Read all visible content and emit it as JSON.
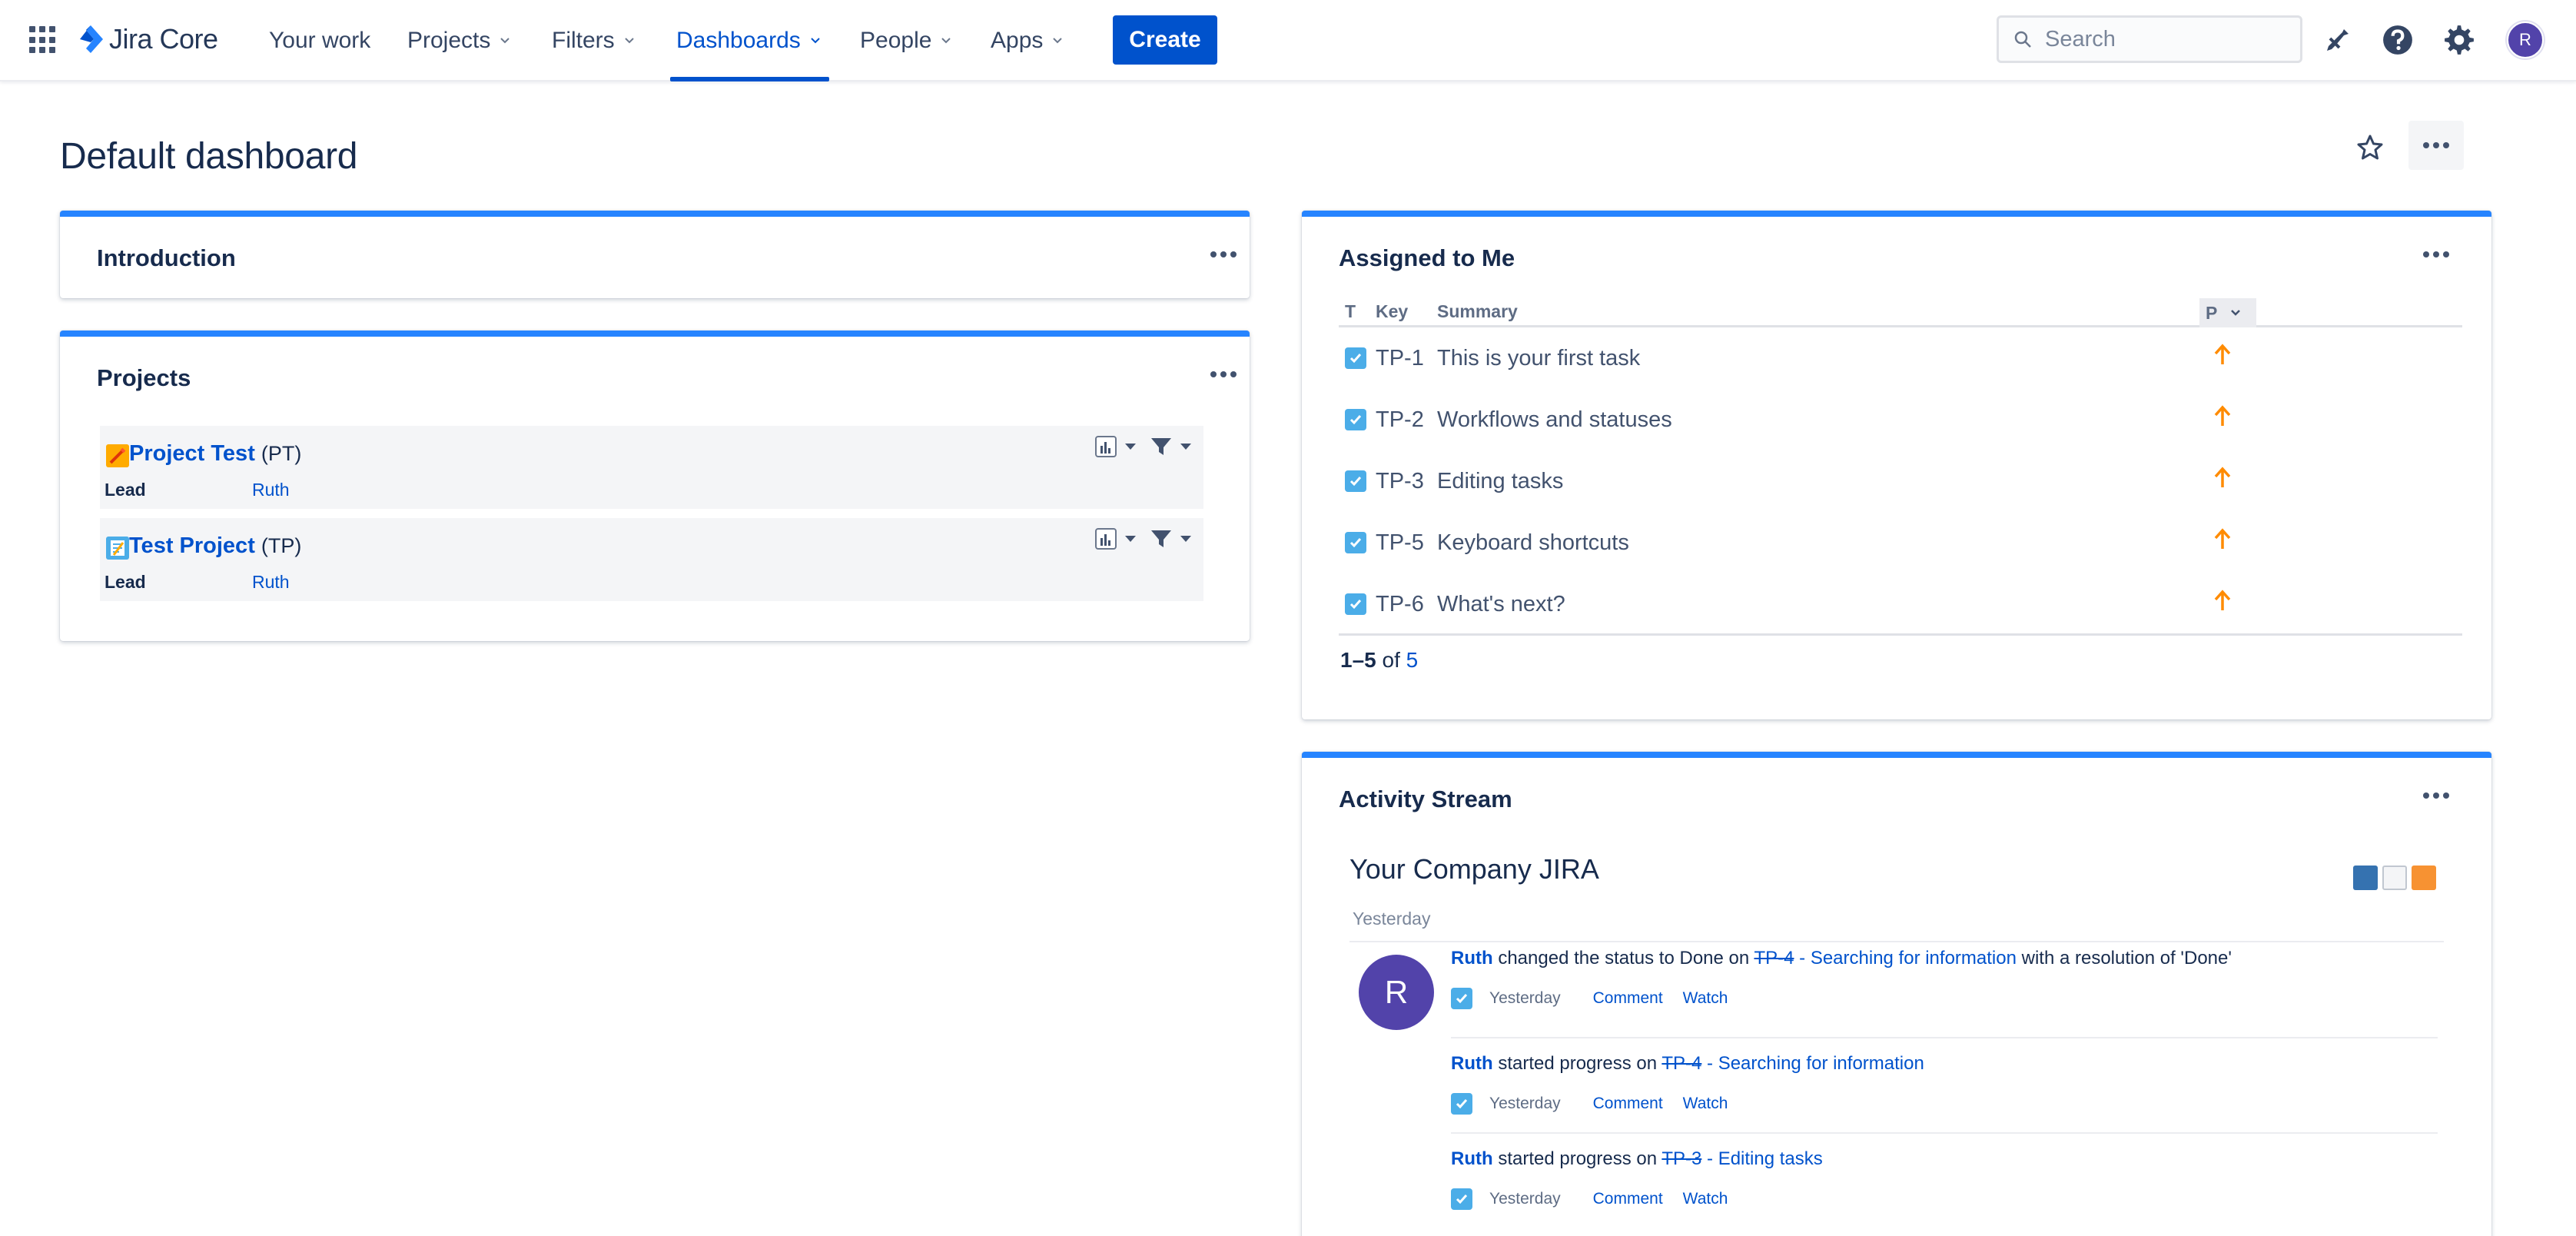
{
  "nav": {
    "product": "Jira Core",
    "items": [
      {
        "label": "Your work",
        "has_menu": false
      },
      {
        "label": "Projects",
        "has_menu": true
      },
      {
        "label": "Filters",
        "has_menu": true
      },
      {
        "label": "Dashboards",
        "has_menu": true,
        "active": true
      },
      {
        "label": "People",
        "has_menu": true
      },
      {
        "label": "Apps",
        "has_menu": true
      }
    ],
    "create_label": "Create",
    "search_placeholder": "Search",
    "avatar_initial": "R",
    "accent": "#0052cc"
  },
  "page": {
    "title": "Default dashboard"
  },
  "gadgets": {
    "introduction": {
      "title": "Introduction"
    },
    "projects": {
      "title": "Projects",
      "items": [
        {
          "name": "Project Test",
          "key": "(PT)",
          "lead_label": "Lead",
          "lead": "Ruth"
        },
        {
          "name": "Test Project",
          "key": "(TP)",
          "lead_label": "Lead",
          "lead": "Ruth"
        }
      ]
    },
    "assigned": {
      "title": "Assigned to Me",
      "columns": {
        "t": "T",
        "key": "Key",
        "summary": "Summary",
        "p": "P"
      },
      "rows": [
        {
          "key": "TP-1",
          "summary": "This is your first task"
        },
        {
          "key": "TP-2",
          "summary": "Workflows and statuses"
        },
        {
          "key": "TP-3",
          "summary": "Editing tasks"
        },
        {
          "key": "TP-5",
          "summary": "Keyboard shortcuts"
        },
        {
          "key": "TP-6",
          "summary": "What's next?"
        }
      ],
      "pager": {
        "range": "1–5",
        "of": "of",
        "total": "5"
      },
      "priority_color": "#ff8b00",
      "type_color": "#4bade8"
    },
    "activity": {
      "title": "Activity Stream",
      "stream_title": "Your Company JIRA",
      "date_group": "Yesterday",
      "avatar_initial": "R",
      "entries": [
        {
          "user": "Ruth",
          "text1": " changed the status to Done on ",
          "link_key": "TP-4",
          "link_rest": " - Searching for information",
          "text2": " with a resolution of 'Done'",
          "when": "Yesterday",
          "comment": "Comment",
          "watch": "Watch"
        },
        {
          "user": "Ruth",
          "text1": " started progress on ",
          "link_key": "TP-4",
          "link_rest": " - Searching for information",
          "text2": "",
          "when": "Yesterday",
          "comment": "Comment",
          "watch": "Watch"
        },
        {
          "user": "Ruth",
          "text1": " started progress on ",
          "link_key": "TP-3",
          "link_rest": " - Editing tasks",
          "text2": "",
          "when": "Yesterday",
          "comment": "Comment",
          "watch": "Watch"
        }
      ]
    }
  }
}
